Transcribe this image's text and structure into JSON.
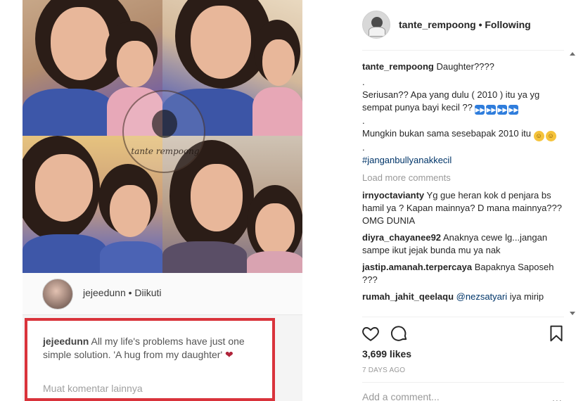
{
  "post": {
    "media": {
      "watermark_text": "tante rempoong",
      "embedded_post": {
        "username": "jejeedunn",
        "follow_status": "Diikuti",
        "comment_user": "jejeedunn",
        "comment_text": "All my life's problems have just one simple solution. 'A hug from my daughter'",
        "heart": "❤",
        "load_more": "Muat komentar lainnya"
      }
    },
    "header": {
      "username": "tante_rempoong",
      "separator": "•",
      "follow_status": "Following",
      "avatar_icon": "profile-avatar"
    },
    "caption": {
      "username": "tante_rempoong",
      "title": "Daughter????",
      "dot1": ".",
      "line1": "Seriusan?? Apa yang dulu ( 2010 ) itu ya yg sempat punya bayi kecil ??",
      "fast_forward_emoji": "⏩",
      "dot2": ".",
      "line2": "Mungkin bukan sama sesebapak 2010 itu",
      "smile_emoji": "😇",
      "dot3": ".",
      "hashtag": "#janganbullyanakkecil"
    },
    "load_more": "Load more comments",
    "comments": [
      {
        "user": "irnyoctavianty",
        "text": "Yg gue heran kok d penjara bs hamil ya ? Kapan mainnya? D mana mainnya??? OMG DUNIA"
      },
      {
        "user": "diyra_chayanee92",
        "text": "Anaknya cewe lg...jangan sampe ikut jejak bunda mu ya nak"
      },
      {
        "user": "jastip.amanah.terpercaya",
        "text": "Bapaknya Saposeh ???"
      },
      {
        "user": "rumah_jahit_qeelaqu",
        "mention": "@nezsatyari",
        "text": "iya mirip"
      }
    ],
    "actions": {
      "like_icon": "heart-icon",
      "comment_icon": "comment-bubble-icon",
      "save_icon": "bookmark-icon"
    },
    "likes": "3,699 likes",
    "timestamp": "7 DAYS AGO",
    "add_comment_placeholder": "Add a comment...",
    "more_options": "..."
  }
}
